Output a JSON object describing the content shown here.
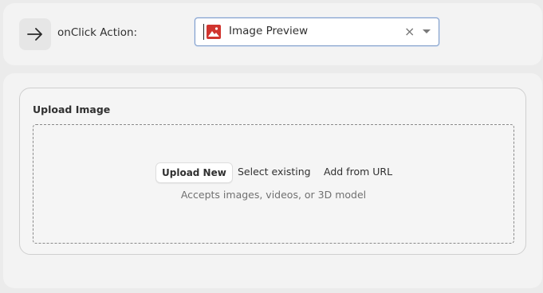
{
  "action": {
    "label": "onClick Action:",
    "selected_value": "Image Preview",
    "clear_symbol": "×",
    "arrow_icon": "arrow-right-icon",
    "value_icon": "image-icon",
    "value_icon_color": "#d0352f"
  },
  "upload": {
    "title": "Upload Image",
    "upload_new_label": "Upload New",
    "select_existing_label": "Select existing",
    "add_url_label": "Add from URL",
    "accepts_text": "Accepts images, videos, or 3D model"
  },
  "colors": {
    "background": "#ebebeb",
    "panel": "#f3f3f3",
    "select_border": "#7f9cc8"
  }
}
